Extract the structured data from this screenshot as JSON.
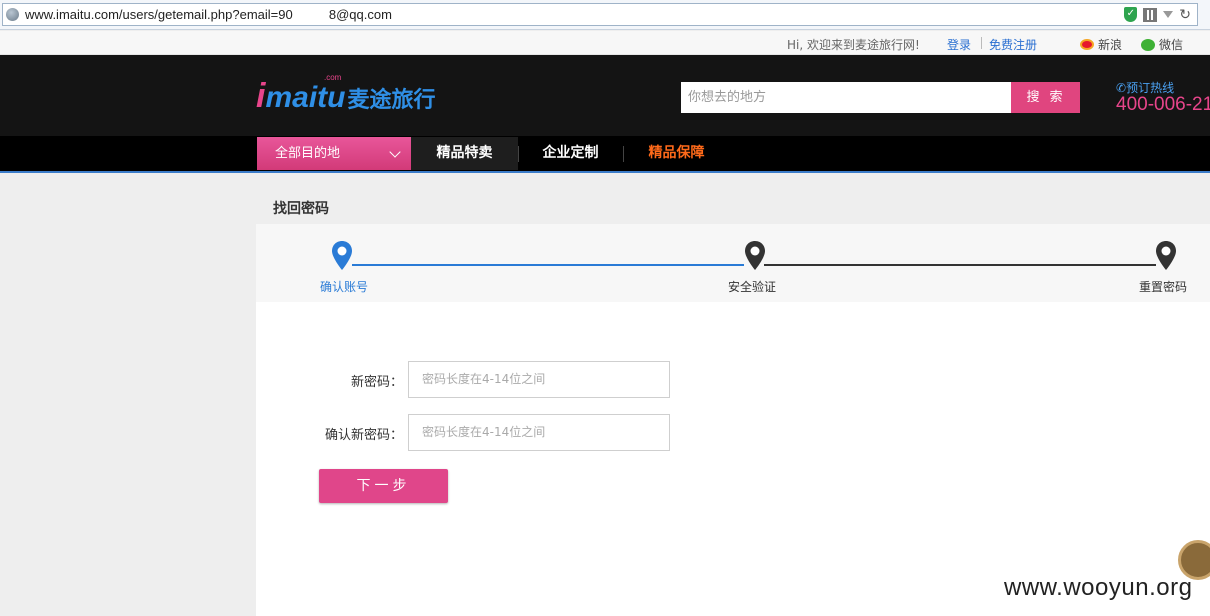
{
  "browser": {
    "url": "www.imaitu.com/users/getemail.php?email=90     8@qq.com"
  },
  "topbar": {
    "welcome": "Hi, 欢迎来到麦途旅行网!",
    "login": "登录",
    "register": "免费注册",
    "weibo": "新浪",
    "wechat": "微信"
  },
  "header": {
    "logo_text": "imaitu",
    "logo_cn": "麦途旅行",
    "logo_com": ".com",
    "search_placeholder": "你想去的地方",
    "search_button": "搜索",
    "hotline_label": "预订热线",
    "hotline_number": "400-006-21"
  },
  "nav": {
    "all_destinations": "全部目的地",
    "items": [
      "精品特卖",
      "企业定制",
      "精品保障"
    ]
  },
  "page": {
    "title": "找回密码",
    "steps": [
      "确认账号",
      "安全验证",
      "重置密码"
    ],
    "form": {
      "new_password_label": "新密码：",
      "new_password_placeholder": "密码长度在4-14位之间",
      "confirm_password_label": "确认新密码：",
      "confirm_password_placeholder": "密码长度在4-14位之间",
      "next_button": "下一步"
    }
  },
  "watermark": "www.wooyun.org",
  "colors": {
    "brand_pink": "#e0457f",
    "brand_blue": "#2f8fe6",
    "active_step": "#2a7bd6",
    "inactive_step": "#333333",
    "nav_orange": "#ff6a1a"
  }
}
